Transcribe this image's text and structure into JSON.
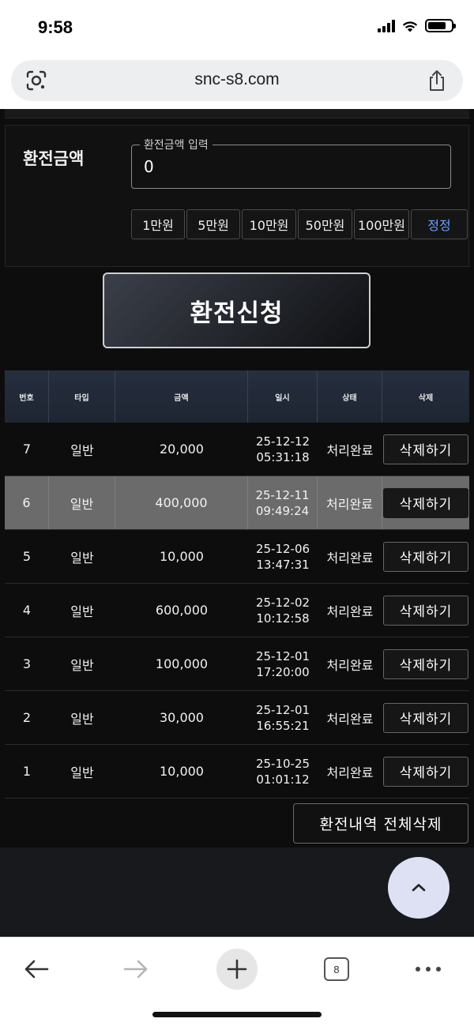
{
  "status_bar": {
    "time": "9:58",
    "icons": [
      "signal-icon",
      "wifi-icon",
      "battery-icon"
    ]
  },
  "browser": {
    "url": "snc-s8.com",
    "tab_count": "8"
  },
  "exchange_form": {
    "label": "환전금액",
    "input_legend": "환전금액 입력",
    "input_value": "0",
    "quick_amounts": [
      "1만원",
      "5만원",
      "10만원",
      "50만원",
      "100만원"
    ],
    "reset_label": "정정",
    "submit_label": "환전신청"
  },
  "table": {
    "headers": [
      "번호",
      "타입",
      "금액",
      "일시",
      "상태",
      "삭제"
    ],
    "rows": [
      {
        "no": "7",
        "type": "일반",
        "amount": "20,000",
        "date": "25-12-12",
        "time": "05:31:18",
        "status": "처리완료",
        "action": "삭제하기"
      },
      {
        "no": "6",
        "type": "일반",
        "amount": "400,000",
        "date": "25-12-11",
        "time": "09:49:24",
        "status": "처리완료",
        "action": "삭제하기"
      },
      {
        "no": "5",
        "type": "일반",
        "amount": "10,000",
        "date": "25-12-06",
        "time": "13:47:31",
        "status": "처리완료",
        "action": "삭제하기"
      },
      {
        "no": "4",
        "type": "일반",
        "amount": "600,000",
        "date": "25-12-02",
        "time": "10:12:58",
        "status": "처리완료",
        "action": "삭제하기"
      },
      {
        "no": "3",
        "type": "일반",
        "amount": "100,000",
        "date": "25-12-01",
        "time": "17:20:00",
        "status": "처리완료",
        "action": "삭제하기"
      },
      {
        "no": "2",
        "type": "일반",
        "amount": "30,000",
        "date": "25-12-01",
        "time": "16:55:21",
        "status": "처리완료",
        "action": "삭제하기"
      },
      {
        "no": "1",
        "type": "일반",
        "amount": "10,000",
        "date": "25-10-25",
        "time": "01:01:12",
        "status": "처리완료",
        "action": "삭제하기"
      }
    ],
    "highlighted_row": 1,
    "clear_all_label": "환전내역 전체삭제"
  },
  "colors": {
    "page_bg": "#0d0d0d",
    "header_bg": "#262f3f",
    "highlight_row": "#6b6b6b",
    "reset_accent": "#6aa0ff",
    "scroll_top_bg": "#dde1f3"
  }
}
